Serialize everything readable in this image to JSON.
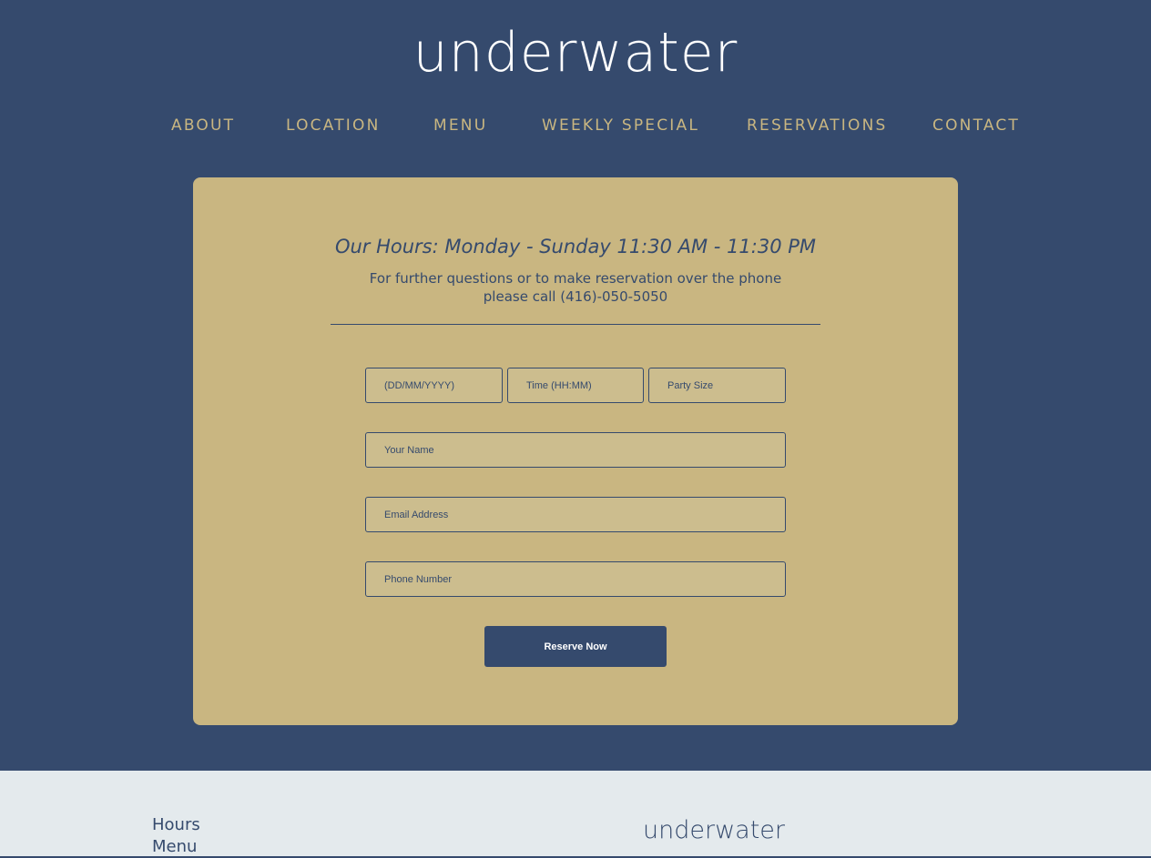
{
  "brand": {
    "logo_text": "underwater"
  },
  "nav": {
    "items": [
      {
        "label": "ABOUT"
      },
      {
        "label": "LOCATION"
      },
      {
        "label": "MENU"
      },
      {
        "label": "WEEKLY SPECIAL"
      },
      {
        "label": "RESERVATIONS"
      },
      {
        "label": "CONTACT"
      }
    ]
  },
  "reservation": {
    "hours_title": "Our Hours: Monday - Sunday 11:30 AM - 11:30 PM",
    "phone_note_line1": "For further questions or to make reservation over the phone",
    "phone_note_line2": "please call (416)-050-5050",
    "fields": {
      "date_placeholder": "(DD/MM/YYYY)",
      "time_placeholder": "Time (HH:MM)",
      "party_placeholder": "Party Size",
      "name_placeholder": "Your Name",
      "email_placeholder": "Email Address",
      "phone_placeholder": "Phone Number"
    },
    "submit_label": "Reserve Now"
  },
  "footer": {
    "links": [
      {
        "label": "Hours"
      },
      {
        "label": "Menu"
      }
    ],
    "logo_text": "underwater"
  },
  "colors": {
    "navy": "#354a6d",
    "gold": "#c9b681",
    "footer_bg": "#e4eaed",
    "white": "#ffffff"
  }
}
